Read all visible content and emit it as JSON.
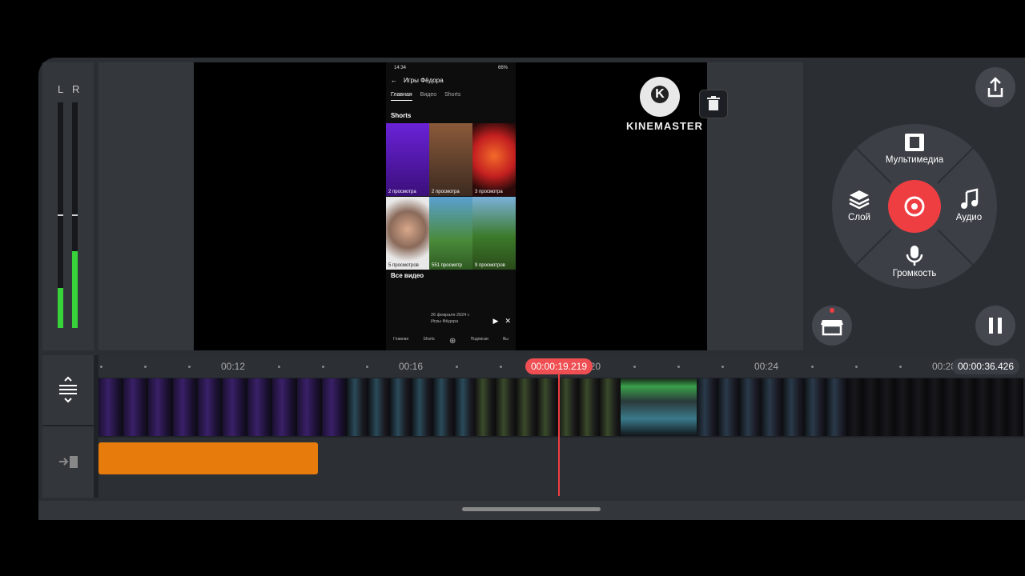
{
  "vu_meter": {
    "left_label": "L",
    "right_label": "R",
    "left_level": 0.18,
    "right_level": 0.34
  },
  "preview": {
    "phone": {
      "status_time": "14:34",
      "status_battery": "66%",
      "channel_title": "Игры Фёдора",
      "tabs": [
        "Главная",
        "Видео",
        "Shorts"
      ],
      "section_shorts": "Shorts",
      "views": [
        "2 просмотра",
        "2 просмотра",
        "3 просмотра",
        "5 просмотров",
        "551 просмотр",
        "9 просмотров"
      ],
      "section_all": "Все видео",
      "mini_date": "26 февраля 2024 г.",
      "mini_channel": "Игры Фёдора",
      "nav": [
        "Главная",
        "Shorts",
        "",
        "Подписки",
        "Вы"
      ]
    },
    "watermark": "KINEMASTER",
    "watermark_letter": "K"
  },
  "wheel": {
    "top": "Мультимедиа",
    "left": "Слой",
    "right": "Аудио",
    "bottom": "Громкость"
  },
  "timeline": {
    "ticks": [
      "00:12",
      "00:16",
      "00:20",
      "00:24",
      "00:28"
    ],
    "current_time": "00:00:19.219",
    "total_time": "00:00:36.426"
  },
  "colors": {
    "accent": "#ef3e42",
    "layer_clip": "#e77c0c",
    "vu_green": "#38d23a"
  }
}
